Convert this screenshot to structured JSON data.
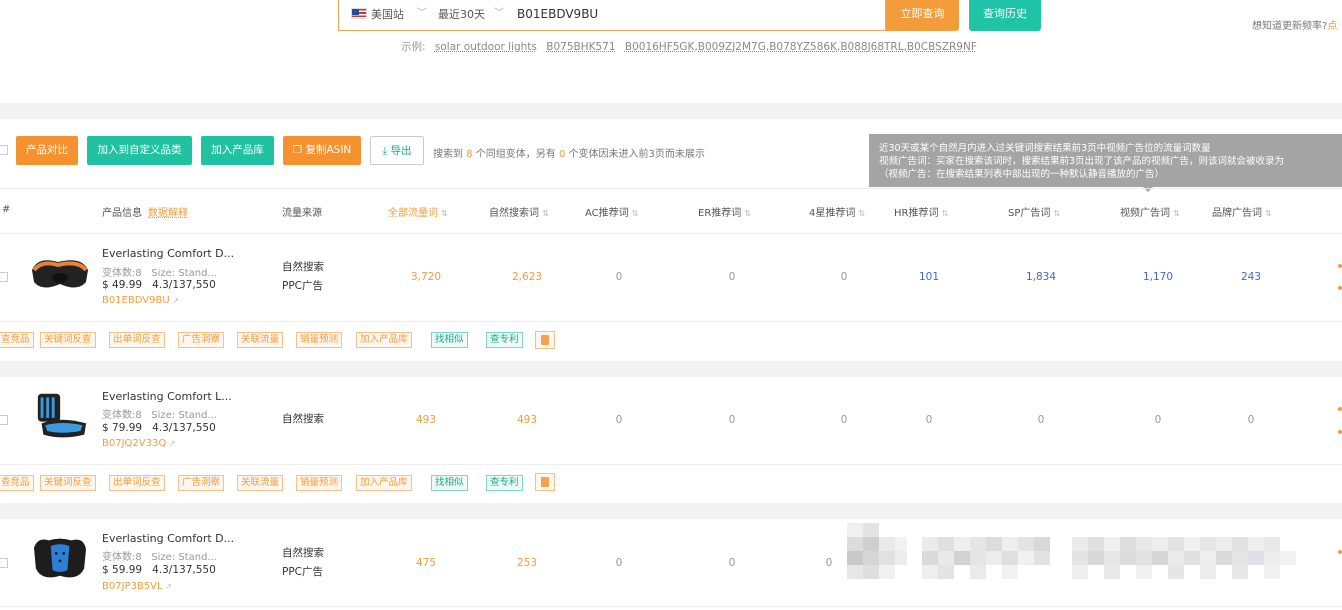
{
  "search": {
    "site": "美国站",
    "range": "最近30天",
    "query": "B01EBDV9BU",
    "submit": "立即查询",
    "history": "查询历史",
    "right_hint": "想知道更新频率?",
    "right_hint_link": "点"
  },
  "examples": {
    "label": "示例:",
    "items": [
      "solar outdoor lights",
      "B075BHK571",
      "B0016HF5GK,B009ZJ2M7G,B078YZ586K,B088J68TRL,B0CBSZR9NF"
    ]
  },
  "toolbar": {
    "compare": "产品对比",
    "add_category": "加入到自定义品类",
    "add_library": "加入产品库",
    "copy_asin": "复制ASIN",
    "export": "导出",
    "info_prefix": "搜索到",
    "info_count": "8",
    "info_mid": "个同组变体，另有",
    "info_hidden": "0",
    "info_suffix": "个变体因未进入前3页而未展示"
  },
  "tooltip": {
    "line1": "近30天或某个自然月内进入过关键词搜索结果前3页中视频广告位的流量词数量",
    "line2": "视频广告词：买家在搜索该词时，搜索结果前3页出现了该产品的视频广告，则该词就会被收录为",
    "line3": "（视频广告：在搜索结果列表中部出现的一种默认静音播放的广告）"
  },
  "table": {
    "col_index": "#",
    "col_product": "产品信息",
    "col_product_link": "数据解释",
    "col_source": "流量来源",
    "col_all": "全部流量词",
    "col_organic": "自然搜索词",
    "col_ac": "AC推荐词",
    "col_er": "ER推荐词",
    "col_4star": "4星推荐词",
    "col_hr": "HR推荐词",
    "col_sp": "SP广告词",
    "col_video": "视频广告词",
    "col_brand": "品牌广告词"
  },
  "tags": [
    "查竞品",
    "关键词反查",
    "出单词反查",
    "广告洞察",
    "关联流量",
    "销量预测",
    "加入产品库",
    "找相似",
    "查专利"
  ],
  "rows": [
    {
      "name": "Everlasting Comfort D...",
      "variants": "变体数:8",
      "size": "Size: Stand...",
      "price": "$ 49.99",
      "rating": "4.3/137,550",
      "asin": "B01EBDV9BU",
      "source1": "自然搜索",
      "source2": "PPC广告",
      "all": "3,720",
      "organic": "2,623",
      "ac": "0",
      "er": "0",
      "star4": "0",
      "hr": "101",
      "sp": "1,834",
      "video": "1,170",
      "brand": "243"
    },
    {
      "name": "Everlasting Comfort L...",
      "variants": "变体数:8",
      "size": "Size: Stand...",
      "price": "$ 79.99",
      "rating": "4.3/137,550",
      "asin": "B07JQ2V33Q",
      "source1": "自然搜索",
      "source2": "",
      "all": "493",
      "organic": "493",
      "ac": "0",
      "er": "0",
      "star4": "0",
      "hr": "0",
      "sp": "0",
      "video": "0",
      "brand": "0"
    },
    {
      "name": "Everlasting Comfort D...",
      "variants": "变体数:8",
      "size": "Size: Stand...",
      "price": "$ 59.99",
      "rating": "4.3/137,550",
      "asin": "B07JP3B5VL",
      "source1": "自然搜索",
      "source2": "PPC广告",
      "all": "475",
      "organic": "253",
      "ac": "0",
      "er": "0",
      "star4": "0"
    }
  ]
}
